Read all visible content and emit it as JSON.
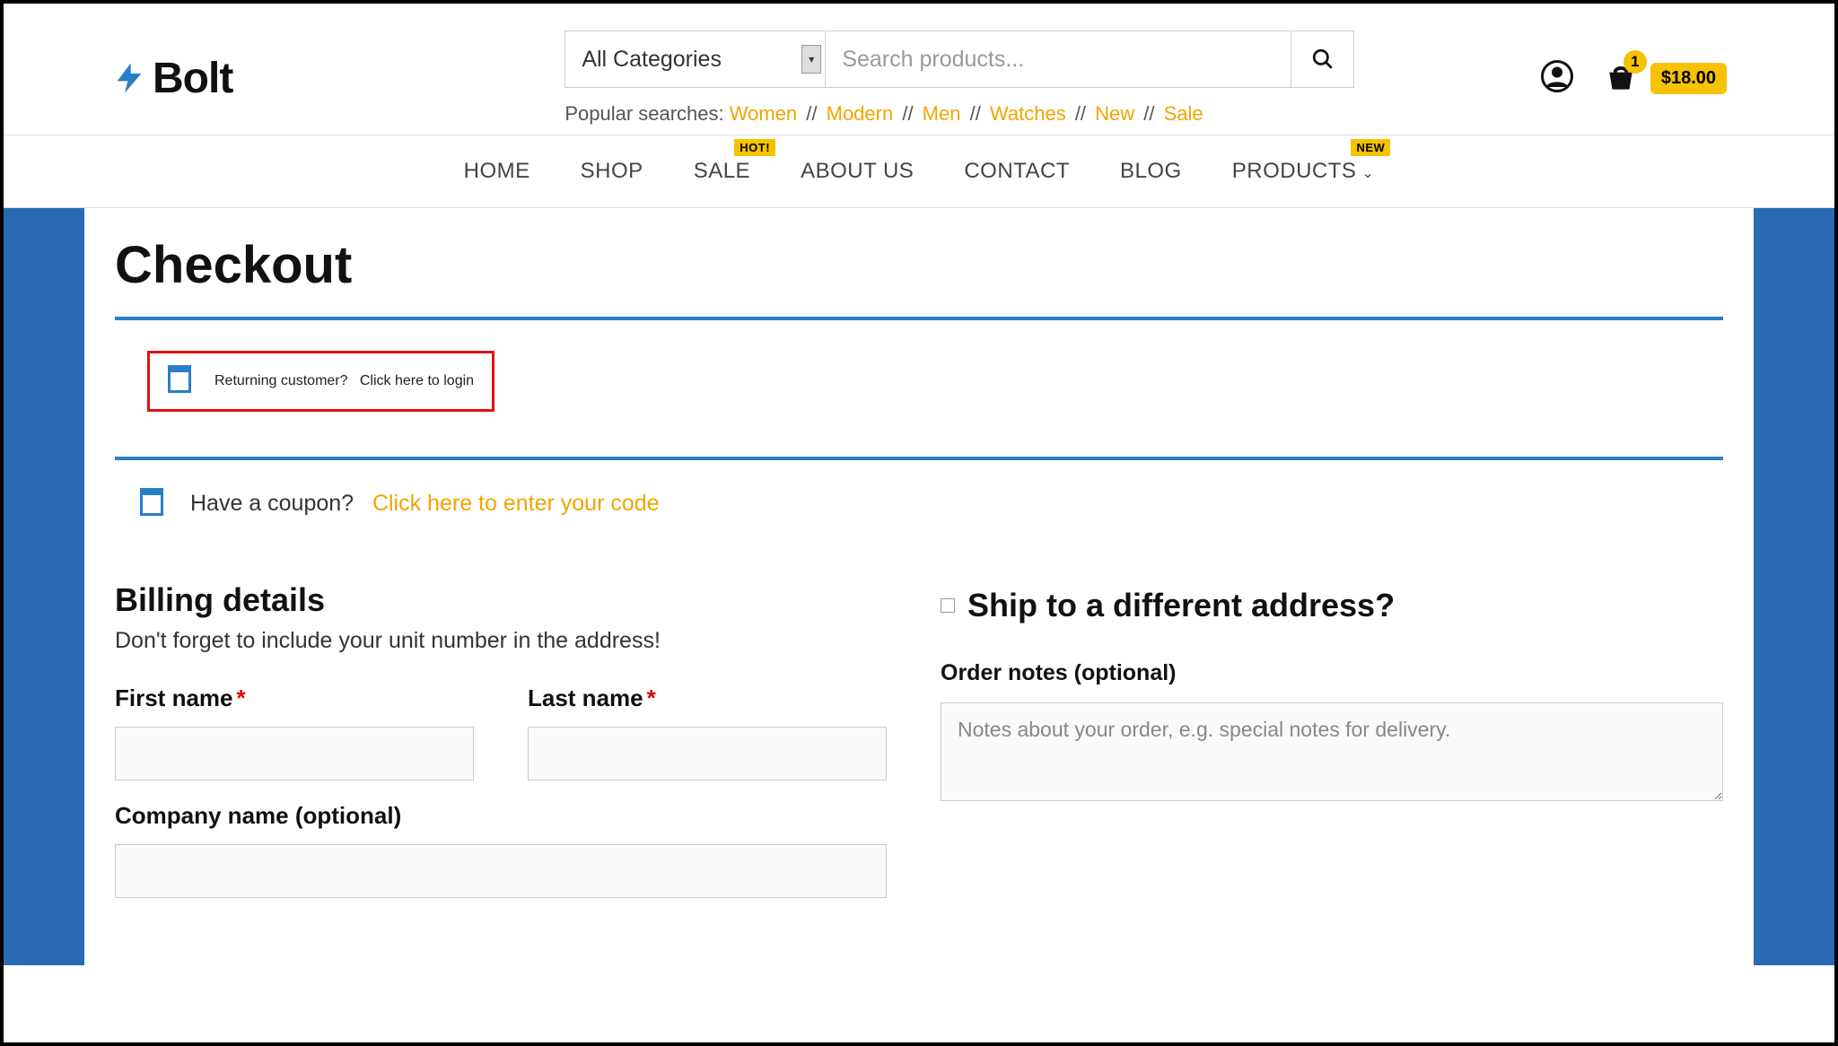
{
  "logo": {
    "text": "Bolt"
  },
  "search": {
    "category": "All Categories",
    "placeholder": "Search products..."
  },
  "popular": {
    "label": "Popular searches:",
    "links": [
      "Women",
      "Modern",
      "Men",
      "Watches",
      "New",
      "Sale"
    ]
  },
  "cart": {
    "count": "1",
    "total": "$18.00"
  },
  "nav": [
    {
      "label": "HOME"
    },
    {
      "label": "SHOP"
    },
    {
      "label": "SALE",
      "badge": "HOT!"
    },
    {
      "label": "ABOUT US"
    },
    {
      "label": "CONTACT"
    },
    {
      "label": "BLOG"
    },
    {
      "label": "PRODUCTS",
      "badge": "NEW",
      "dropdown": true
    }
  ],
  "page": {
    "title": "Checkout"
  },
  "notices": {
    "returning_prefix": "Returning customer?",
    "returning_link": "Click here to login",
    "coupon_prefix": "Have a coupon?",
    "coupon_link": "Click here to enter your code"
  },
  "billing": {
    "title": "Billing details",
    "subtitle": "Don't forget to include your unit number in the address!",
    "first_name_label": "First name",
    "last_name_label": "Last name",
    "company_label": "Company name (optional)"
  },
  "shipping": {
    "title": "Ship to a different address?",
    "notes_label": "Order notes (optional)",
    "notes_placeholder": "Notes about your order, e.g. special notes for delivery."
  }
}
